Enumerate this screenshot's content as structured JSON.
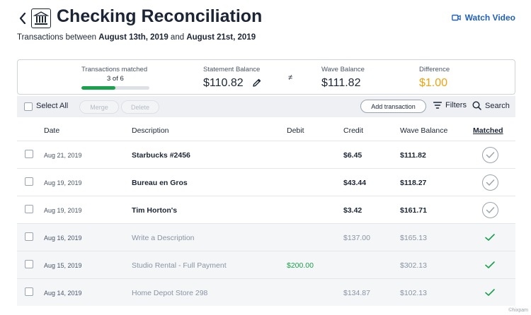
{
  "header": {
    "title": "Checking Reconciliation",
    "watch_video": "Watch Video",
    "subtitle_prefix": "Transactions between",
    "date_start": "August 13th, 2019",
    "subtitle_join": "and",
    "date_end": "August 21st, 2019"
  },
  "summary": {
    "matched_label": "Transactions matched",
    "matched_count": "3 of 6",
    "matched_fraction": 0.5,
    "statement_label": "Statement Balance",
    "statement_value": "$110.82",
    "neq_symbol": "≠",
    "wave_label": "Wave Balance",
    "wave_value": "$111.82",
    "difference_label": "Difference",
    "difference_value": "$1.00",
    "difference_color": "#f2a10f"
  },
  "toolbar": {
    "select_all": "Select All",
    "merge": "Merge",
    "delete": "Delete",
    "add_transaction": "Add transaction",
    "filters": "Filters",
    "search": "Search"
  },
  "table": {
    "headers": {
      "date": "Date",
      "description": "Description",
      "debit": "Debit",
      "credit": "Credit",
      "wave_balance": "Wave Balance",
      "matched": "Matched"
    },
    "rows": [
      {
        "date": "Aug 21, 2019",
        "description": "Starbucks #2456",
        "debit": "",
        "credit": "$6.45",
        "balance": "$111.82",
        "matched": false
      },
      {
        "date": "Aug 19, 2019",
        "description": "Bureau en Gros",
        "debit": "",
        "credit": "$43.44",
        "balance": "$118.27",
        "matched": false
      },
      {
        "date": "Aug 19, 2019",
        "description": "Tim Horton's",
        "debit": "",
        "credit": "$3.42",
        "balance": "$161.71",
        "matched": false
      },
      {
        "date": "Aug 16, 2019",
        "description": "Write a Description",
        "debit": "",
        "credit": "$137.00",
        "balance": "$165.13",
        "matched": true
      },
      {
        "date": "Aug 15, 2019",
        "description": "Studio Rental - Full Payment",
        "debit": "$200.00",
        "credit": "",
        "balance": "$302.13",
        "matched": true
      },
      {
        "date": "Aug 14, 2019",
        "description": "Home Depot Store 298",
        "debit": "",
        "credit": "$134.87",
        "balance": "$102.13",
        "matched": true
      }
    ]
  },
  "colors": {
    "accent_blue": "#1f5fbf",
    "match_green": "#19a14b"
  },
  "watermark": "©hixpam"
}
